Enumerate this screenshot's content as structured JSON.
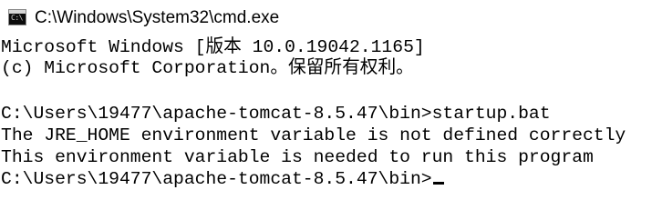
{
  "window": {
    "title": "C:\\Windows\\System32\\cmd.exe",
    "icon_label": "C:\\"
  },
  "console": {
    "lines": [
      "Microsoft Windows [版本 10.0.19042.1165]",
      "(c) Microsoft Corporation。保留所有权利。",
      "",
      "C:\\Users\\19477\\apache-tomcat-8.5.47\\bin>startup.bat",
      "The JRE_HOME environment variable is not defined correctly",
      "This environment variable is needed to run this program",
      "C:\\Users\\19477\\apache-tomcat-8.5.47\\bin>"
    ]
  }
}
